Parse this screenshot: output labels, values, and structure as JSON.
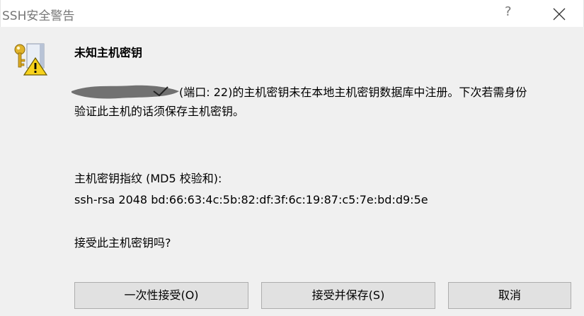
{
  "window": {
    "title": "SSH安全警告",
    "help_glyph": "?",
    "close_icon": "close-icon"
  },
  "dialog": {
    "icon": "key-warning-icon",
    "heading": "未知主机密钥",
    "message_host_redacted": true,
    "message_line1": "(端口: 22)的主机密钥未在本地主机密钥数据库中注册。下次若需身份",
    "message_line2": "验证此主机的话须保存主机密钥。",
    "fingerprint_label": "主机密钥指纹 (MD5 校验和):",
    "fingerprint_value": "ssh-rsa 2048 bd:66:63:4c:5b:82:df:3f:6c:19:87:c5:7e:bd:d9:5e",
    "question": "接受此主机密钥吗?"
  },
  "buttons": {
    "accept_once": "一次性接受(O)",
    "accept_save": "接受并保存(S)",
    "cancel": "取消"
  },
  "colors": {
    "titlebar_bg": "#ffffff",
    "dialog_bg": "#f0f0f0",
    "button_bg": "#e1e1e1",
    "button_border": "#adadad"
  }
}
